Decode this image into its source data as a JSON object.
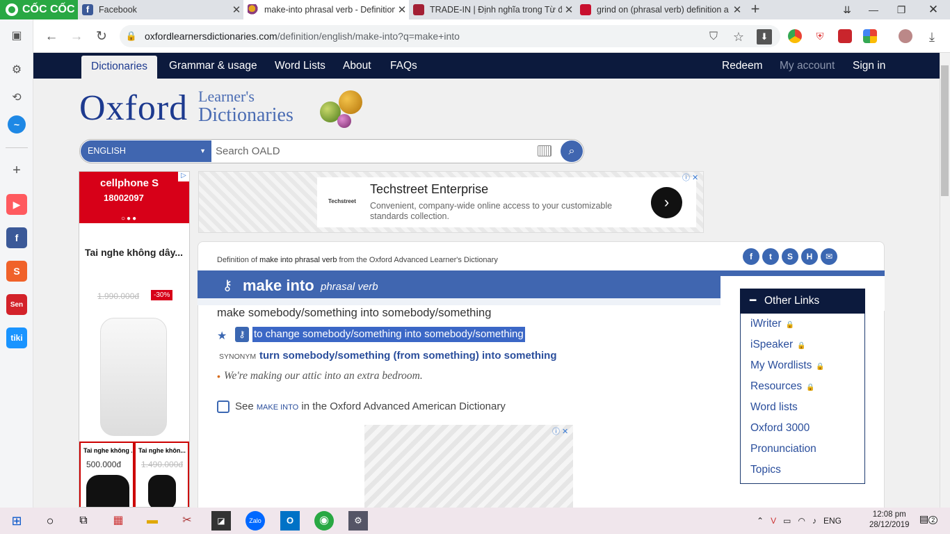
{
  "browser": {
    "tabs": [
      {
        "title": "Facebook",
        "active": false
      },
      {
        "title": "make-into phrasal verb - Definition",
        "active": true
      },
      {
        "title": "TRADE-IN | Định nghĩa trong Từ đi",
        "active": false
      },
      {
        "title": "grind on (phrasal verb) definition a",
        "active": false
      }
    ],
    "brand": "CỐC CỐC",
    "url_host": "oxfordlearnersdictionaries.com",
    "url_path": "/definition/english/make-into?q=make+into"
  },
  "site_nav": {
    "items": [
      "Dictionaries",
      "Grammar & usage",
      "Word Lists",
      "About",
      "FAQs"
    ],
    "right": [
      "Redeem",
      "My account",
      "Sign in"
    ]
  },
  "logo": {
    "oxford": "Oxford",
    "learners": "Learner's",
    "dictionaries": "Dictionaries"
  },
  "search": {
    "language": "ENGLISH",
    "placeholder": "Search OALD"
  },
  "left_ad": {
    "brand": "cellphone S",
    "phone": "18002097",
    "title": "Tai nghe không dây...",
    "old_price": "1.990.000đ",
    "discount": "-30%",
    "products": [
      {
        "title": "Tai nghe không ...",
        "price": "500.000đ",
        "old": false
      },
      {
        "title": "Tai nghe khôn...",
        "price": "1.490.000đ",
        "old": true
      }
    ]
  },
  "banner_ad": {
    "logo": "Techstreet",
    "title": "Techstreet Enterprise",
    "description": "Convenient, company-wide online access to your customizable standards collection."
  },
  "entry": {
    "definition_of_prefix": "Definition of",
    "definition_of_word": "make into phrasal verb",
    "definition_of_suffix": "from the Oxford Advanced Learner's Dictionary",
    "headword": "make into",
    "pos": "phrasal verb",
    "pattern": "make somebody/something into somebody/something",
    "sense": "to change somebody/something into somebody/something",
    "synonym_label": "SYNONYM",
    "synonym": "turn somebody/something (from something) into something",
    "example": "We're making our attic into an extra bedroom.",
    "see_prefix": "See",
    "see_word": "MAKE INTO",
    "see_suffix": "in the Oxford Advanced American Dictionary"
  },
  "other_links": {
    "title": "Other Links",
    "items": [
      {
        "label": "iWriter",
        "locked": true
      },
      {
        "label": "iSpeaker",
        "locked": true
      },
      {
        "label": "My Wordlists",
        "locked": true
      },
      {
        "label": "Resources",
        "locked": true
      },
      {
        "label": "Word lists",
        "locked": false
      },
      {
        "label": "Oxford 3000",
        "locked": false
      },
      {
        "label": "Pronunciation",
        "locked": false
      },
      {
        "label": "Topics",
        "locked": false
      }
    ]
  },
  "taskbar": {
    "language": "ENG",
    "time": "12:08 pm",
    "date": "28/12/2019",
    "notifications": "2"
  },
  "colors": {
    "oxford_navy": "#0c1a3d",
    "oxford_blue": "#4066b0",
    "coccoc_green": "#29a843"
  }
}
